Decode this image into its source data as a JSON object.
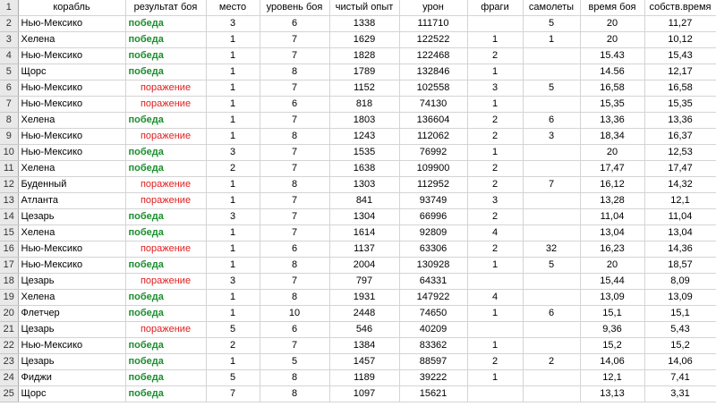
{
  "header": {
    "row_number": "1",
    "columns": [
      "корабль",
      "результат боя",
      "место",
      "уровень боя",
      "чистый опыт",
      "урон",
      "фраги",
      "самолеты",
      "время боя",
      "собств.время"
    ]
  },
  "rows": [
    {
      "n": "2",
      "ship": "Нью-Мексико",
      "result": "победа",
      "win": true,
      "place": "3",
      "level": "6",
      "exp": "1338",
      "damage": "111710",
      "frags": "",
      "planes": "5",
      "time": "20",
      "own": "11,27"
    },
    {
      "n": "3",
      "ship": "Хелена",
      "result": "победа",
      "win": true,
      "place": "1",
      "level": "7",
      "exp": "1629",
      "damage": "122522",
      "frags": "1",
      "planes": "1",
      "time": "20",
      "own": "10,12"
    },
    {
      "n": "4",
      "ship": "Нью-Мексико",
      "result": "победа",
      "win": true,
      "place": "1",
      "level": "7",
      "exp": "1828",
      "damage": "122468",
      "frags": "2",
      "planes": "",
      "time": "15.43",
      "own": "15,43"
    },
    {
      "n": "5",
      "ship": "Щорс",
      "result": "победа",
      "win": true,
      "place": "1",
      "level": "8",
      "exp": "1789",
      "damage": "132846",
      "frags": "1",
      "planes": "",
      "time": "14.56",
      "own": "12,17"
    },
    {
      "n": "6",
      "ship": "Нью-Мексико",
      "result": "поражение",
      "win": false,
      "place": "1",
      "level": "7",
      "exp": "1152",
      "damage": "102558",
      "frags": "3",
      "planes": "5",
      "time": "16,58",
      "own": "16,58"
    },
    {
      "n": "7",
      "ship": "Нью-Мексико",
      "result": "поражение",
      "win": false,
      "place": "1",
      "level": "6",
      "exp": "818",
      "damage": "74130",
      "frags": "1",
      "planes": "",
      "time": "15,35",
      "own": "15,35"
    },
    {
      "n": "8",
      "ship": "Хелена",
      "result": "победа",
      "win": true,
      "place": "1",
      "level": "7",
      "exp": "1803",
      "damage": "136604",
      "frags": "2",
      "planes": "6",
      "time": "13,36",
      "own": "13,36"
    },
    {
      "n": "9",
      "ship": "Нью-Мексико",
      "result": "поражение",
      "win": false,
      "place": "1",
      "level": "8",
      "exp": "1243",
      "damage": "112062",
      "frags": "2",
      "planes": "3",
      "time": "18,34",
      "own": "16,37"
    },
    {
      "n": "10",
      "ship": "Нью-Мексико",
      "result": "победа",
      "win": true,
      "place": "3",
      "level": "7",
      "exp": "1535",
      "damage": "76992",
      "frags": "1",
      "planes": "",
      "time": "20",
      "own": "12,53"
    },
    {
      "n": "11",
      "ship": "Хелена",
      "result": "победа",
      "win": true,
      "place": "2",
      "level": "7",
      "exp": "1638",
      "damage": "109900",
      "frags": "2",
      "planes": "",
      "time": "17,47",
      "own": "17,47"
    },
    {
      "n": "12",
      "ship": "Буденный",
      "result": "поражение",
      "win": false,
      "place": "1",
      "level": "8",
      "exp": "1303",
      "damage": "112952",
      "frags": "2",
      "planes": "7",
      "time": "16,12",
      "own": "14,32"
    },
    {
      "n": "13",
      "ship": "Атланта",
      "result": "поражение",
      "win": false,
      "place": "1",
      "level": "7",
      "exp": "841",
      "damage": "93749",
      "frags": "3",
      "planes": "",
      "time": "13,28",
      "own": "12,1"
    },
    {
      "n": "14",
      "ship": "Цезарь",
      "result": "победа",
      "win": true,
      "place": "3",
      "level": "7",
      "exp": "1304",
      "damage": "66996",
      "frags": "2",
      "planes": "",
      "time": "11,04",
      "own": "11,04"
    },
    {
      "n": "15",
      "ship": "Хелена",
      "result": "победа",
      "win": true,
      "place": "1",
      "level": "7",
      "exp": "1614",
      "damage": "92809",
      "frags": "4",
      "planes": "",
      "time": "13,04",
      "own": "13,04"
    },
    {
      "n": "16",
      "ship": "Нью-Мексико",
      "result": "поражение",
      "win": false,
      "place": "1",
      "level": "6",
      "exp": "1137",
      "damage": "63306",
      "frags": "2",
      "planes": "32",
      "time": "16,23",
      "own": "14,36"
    },
    {
      "n": "17",
      "ship": "Нью-Мексико",
      "result": "победа",
      "win": true,
      "place": "1",
      "level": "8",
      "exp": "2004",
      "damage": "130928",
      "frags": "1",
      "planes": "5",
      "time": "20",
      "own": "18,57"
    },
    {
      "n": "18",
      "ship": "Цезарь",
      "result": "поражение",
      "win": false,
      "place": "3",
      "level": "7",
      "exp": "797",
      "damage": "64331",
      "frags": "",
      "planes": "",
      "time": "15,44",
      "own": "8,09"
    },
    {
      "n": "19",
      "ship": "Хелена",
      "result": "победа",
      "win": true,
      "place": "1",
      "level": "8",
      "exp": "1931",
      "damage": "147922",
      "frags": "4",
      "planes": "",
      "time": "13,09",
      "own": "13,09"
    },
    {
      "n": "20",
      "ship": "Флетчер",
      "result": "победа",
      "win": true,
      "place": "1",
      "level": "10",
      "exp": "2448",
      "damage": "74650",
      "frags": "1",
      "planes": "6",
      "time": "15,1",
      "own": "15,1"
    },
    {
      "n": "21",
      "ship": "Цезарь",
      "result": "поражение",
      "win": false,
      "place": "5",
      "level": "6",
      "exp": "546",
      "damage": "40209",
      "frags": "",
      "planes": "",
      "time": "9,36",
      "own": "5,43"
    },
    {
      "n": "22",
      "ship": "Нью-Мексико",
      "result": "победа",
      "win": true,
      "place": "2",
      "level": "7",
      "exp": "1384",
      "damage": "83362",
      "frags": "1",
      "planes": "",
      "time": "15,2",
      "own": "15,2"
    },
    {
      "n": "23",
      "ship": "Цезарь",
      "result": "победа",
      "win": true,
      "place": "1",
      "level": "5",
      "exp": "1457",
      "damage": "88597",
      "frags": "2",
      "planes": "2",
      "time": "14,06",
      "own": "14,06"
    },
    {
      "n": "24",
      "ship": "Фиджи",
      "result": "победа",
      "win": true,
      "place": "5",
      "level": "8",
      "exp": "1189",
      "damage": "39222",
      "frags": "1",
      "planes": "",
      "time": "12,1",
      "own": "7,41"
    },
    {
      "n": "25",
      "ship": "Щорс",
      "result": "победа",
      "win": true,
      "place": "7",
      "level": "8",
      "exp": "1097",
      "damage": "15621",
      "frags": "",
      "planes": "",
      "time": "13,13",
      "own": "3,31"
    }
  ]
}
